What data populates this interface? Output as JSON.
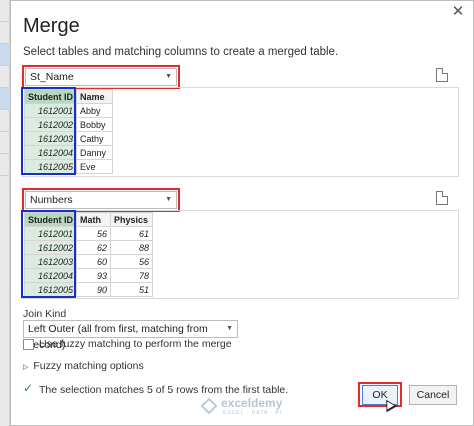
{
  "dialog": {
    "title": "Merge",
    "subtitle": "Select tables and matching columns to create a merged table.",
    "close_glyph": "✕"
  },
  "first_table": {
    "selected": "St_Name",
    "headers": [
      "Student ID",
      "Name"
    ],
    "rows": [
      [
        "1612001",
        "Abby"
      ],
      [
        "1612002",
        "Bobby"
      ],
      [
        "1612003",
        "Cathy"
      ],
      [
        "1612004",
        "Danny"
      ],
      [
        "1612005",
        "Eve"
      ]
    ]
  },
  "second_table": {
    "selected": "Numbers",
    "headers": [
      "Student ID",
      "Math",
      "Physics"
    ],
    "rows": [
      [
        "1612001",
        "56",
        "61"
      ],
      [
        "1612002",
        "62",
        "88"
      ],
      [
        "1612003",
        "60",
        "56"
      ],
      [
        "1612004",
        "93",
        "78"
      ],
      [
        "1612005",
        "90",
        "51"
      ]
    ]
  },
  "join": {
    "label": "Join Kind",
    "selected": "Left Outer (all from first, matching from second)"
  },
  "fuzzy": {
    "checkbox_label": "Use fuzzy matching to perform the merge",
    "checked": false,
    "options_label": "Fuzzy matching options"
  },
  "status": {
    "text": "The selection matches 5 of 5 rows from the first table."
  },
  "buttons": {
    "ok": "OK",
    "cancel": "Cancel"
  },
  "watermark": {
    "name": "exceldemy",
    "tagline": "EXCEL · DATA · BI"
  },
  "colors": {
    "highlight_red": "#e32b2b",
    "highlight_blue": "#1730c9",
    "selected_column": "#dcebdf"
  }
}
